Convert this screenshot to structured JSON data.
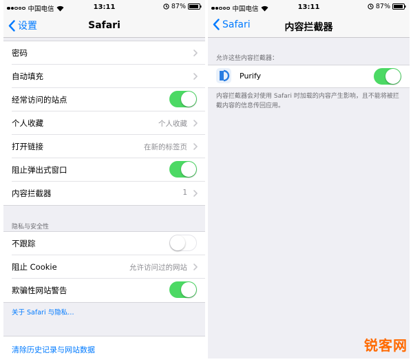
{
  "status_bar_left": {
    "carrier": "中国电信",
    "time": "13:11",
    "battery": "87%"
  },
  "status_bar_right": {
    "carrier": "中国电信",
    "time": "13:11",
    "battery": "87%"
  },
  "left_screen": {
    "back_label": "设置",
    "title": "Safari",
    "rows": [
      {
        "label": "密码"
      },
      {
        "label": "自动填充"
      },
      {
        "label": "经常访问的站点",
        "toggle": "on"
      },
      {
        "label": "个人收藏",
        "value": "个人收藏"
      },
      {
        "label": "打开链接",
        "value": "在新的标签页"
      },
      {
        "label": "阻止弹出式窗口",
        "toggle": "on"
      },
      {
        "label": "内容拦截器",
        "value": "1"
      }
    ],
    "privacy_header": "隐私与安全性",
    "privacy_rows": [
      {
        "label": "不跟踪",
        "toggle": "off"
      },
      {
        "label": "阻止 Cookie",
        "value": "允许访问过的网站"
      },
      {
        "label": "欺骗性网站警告",
        "toggle": "on"
      }
    ],
    "about_link": "关于 Safari 与隐私…",
    "clear_history": "清除历史记录与网站数据"
  },
  "right_screen": {
    "back_label": "Safari",
    "title": "内容拦截器",
    "section_header": "允许这些内容拦截器：",
    "blocker_name": "Purify",
    "blocker_toggle": "on",
    "footer": "内容拦截器会对使用 Safari 时加载的内容产生影响，且不能将被拦截内容的信息传回应用。"
  },
  "watermark": "锐客网",
  "colors": {
    "accent": "#007aff",
    "toggle_on": "#4cd964",
    "watermark": "#ff6a00"
  }
}
